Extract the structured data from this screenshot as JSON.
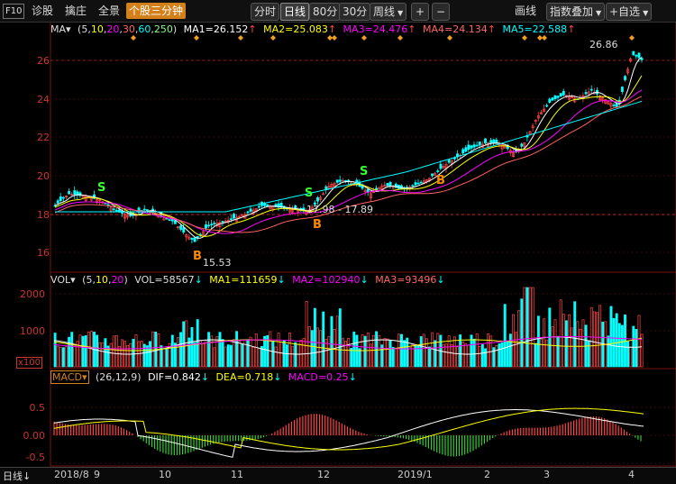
{
  "toolbar": {
    "f10": "F10",
    "diag": "诊股",
    "pick": "擒庄",
    "view": "全景",
    "three_min": "个股三分钟",
    "time_share": "分时",
    "daily": "日线",
    "m80": "80分",
    "m30": "30分",
    "weekly": "周线",
    "weekly_arrow": "▼",
    "plus": "+",
    "minus": "−",
    "draw": "画线",
    "overlay": "指数叠加",
    "add_fav": "+自选"
  },
  "ma_line": {
    "name": "MA▾",
    "params": "(5,10,20,30,60,250)",
    "ma1": "MA1=26.152",
    "ma2": "MA2=25.083",
    "ma3": "MA3=24.476",
    "ma4": "MA4=24.134",
    "ma5": "MA5=22.588",
    "arrow": "↑"
  },
  "vol_line": {
    "name": "VOL▾",
    "params": "(5,10,20)",
    "vol": "VOL=58567",
    "arrow": "↓",
    "ma1": "MA1=111659",
    "ma2": "MA2=102940",
    "ma3": "MA3=93496"
  },
  "macd_line": {
    "name": "MACD▾",
    "params": "(26,12,9)",
    "dif": "DIF=0.842",
    "dea": "DEA=0.718",
    "macd": "MACD=0.25",
    "arrow": "↓"
  },
  "price_axis": [
    "26",
    "24",
    "22",
    "20",
    "18",
    "16"
  ],
  "vol_axis": [
    "2000",
    "1000"
  ],
  "vol_unit": "x100",
  "macd_axis": [
    "0.5",
    "0.00",
    "-0.5"
  ],
  "annotations": {
    "high": "26.86",
    "low": "15.53",
    "range": "17.98 - 17.89",
    "buy": "B",
    "sell": "S"
  },
  "x_axis": [
    "2018/8",
    "9",
    "10",
    "11",
    "12",
    "2019/1",
    "2",
    "3",
    "4"
  ],
  "bottom": {
    "period": "日线",
    "arrow": "↓"
  },
  "colors": {
    "up": "#ff4444",
    "down": "#00ffff",
    "ma5": "#ffffff",
    "ma10": "#ffff00",
    "ma20": "#ff00ff",
    "ma30": "#ff6060",
    "ma60": "#00ffff",
    "accent": "#d4801a"
  }
}
